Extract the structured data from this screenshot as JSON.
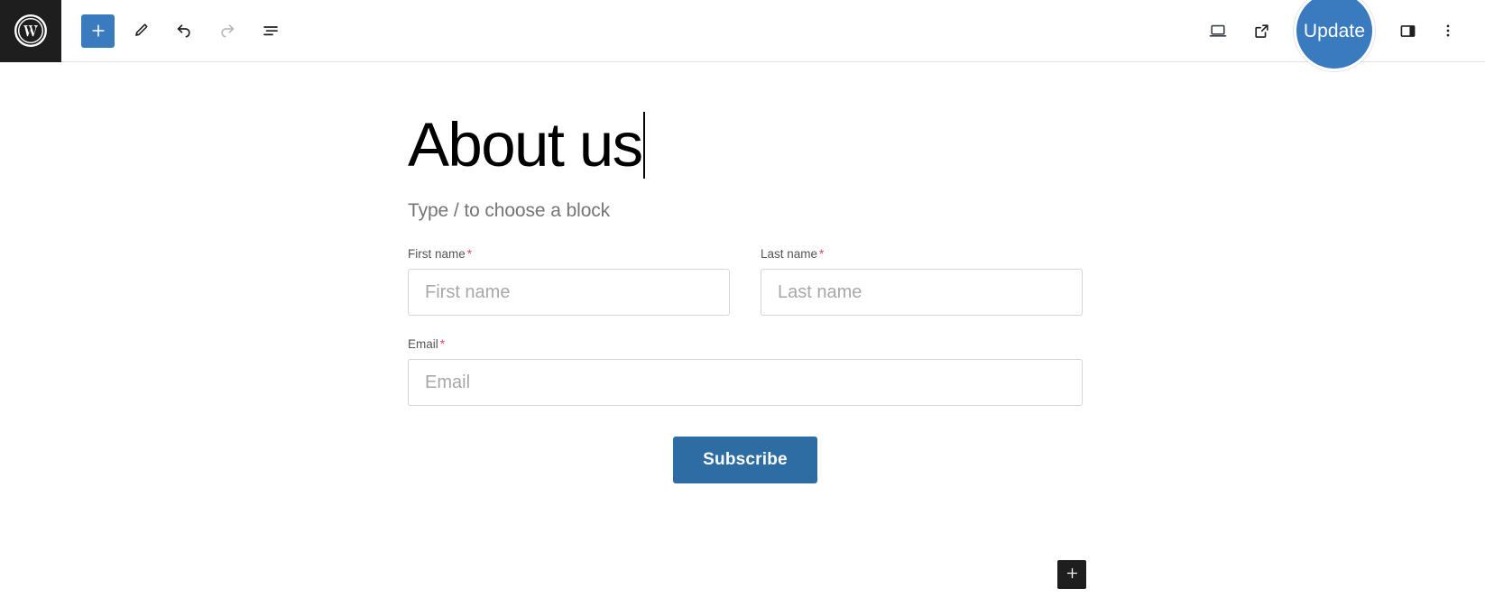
{
  "header": {
    "logo_label": "WordPress",
    "tools": [
      {
        "name": "add-block",
        "label": "Add block",
        "icon": "plus-icon"
      },
      {
        "name": "tools",
        "label": "Tools",
        "icon": "pencil-icon"
      },
      {
        "name": "undo",
        "label": "Undo",
        "icon": "undo-arrow-icon"
      },
      {
        "name": "redo",
        "label": "Redo",
        "icon": "redo-arrow-icon"
      },
      {
        "name": "list-view",
        "label": "Document Overview",
        "icon": "list-view-icon"
      }
    ],
    "right_tools": [
      {
        "name": "preview",
        "label": "Preview",
        "icon": "desktop-icon"
      },
      {
        "name": "view-post",
        "label": "View Post",
        "icon": "external-link-icon"
      },
      {
        "name": "settings-sidebar",
        "label": "Settings",
        "icon": "sidebar-panel-icon"
      },
      {
        "name": "more-options",
        "label": "Options",
        "icon": "three-dots-vertical-icon"
      }
    ],
    "update_label": "Update",
    "accent_color": "#3a7bbf"
  },
  "content": {
    "post_title": "About us",
    "block_placeholder": "Type / to choose a block"
  },
  "form": {
    "fields": [
      {
        "name": "first-name",
        "label": "First name",
        "required_marker": "*",
        "placeholder": "First name",
        "value": ""
      },
      {
        "name": "last-name",
        "label": "Last name",
        "required_marker": "*",
        "placeholder": "Last name",
        "value": ""
      },
      {
        "name": "email",
        "label": "Email",
        "required_marker": "*",
        "placeholder": "Email",
        "value": ""
      }
    ],
    "submit_label": "Subscribe",
    "submit_color": "#2e6da4"
  },
  "appender": {
    "label": "Add block",
    "icon": "plus-icon"
  }
}
